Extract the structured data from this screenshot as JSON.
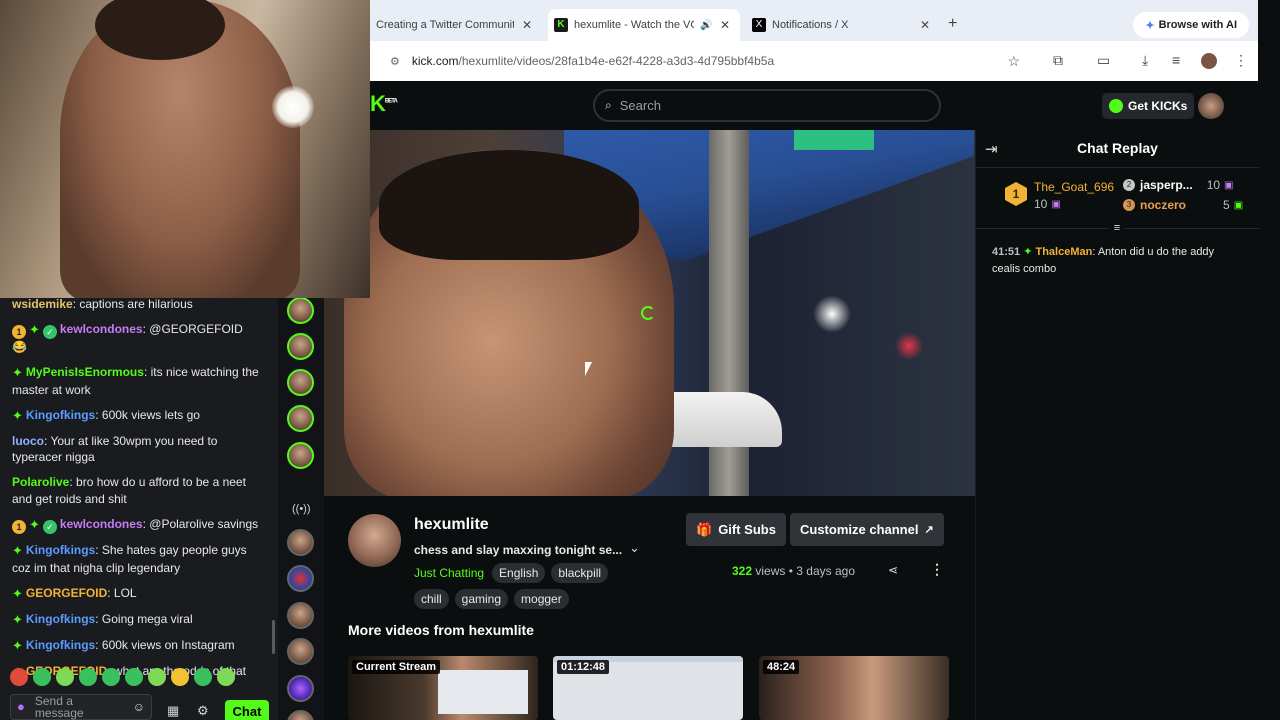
{
  "browser": {
    "tabs": [
      {
        "title": "Creating a Twitter Community",
        "active": false
      },
      {
        "title": "hexumlite - Watch the VO",
        "active": true
      },
      {
        "title": "Notifications / X",
        "active": false
      }
    ],
    "browse_ai": "Browse with AI",
    "url_domain": "kick.com",
    "url_path": "/hexumlite/videos/28fa1b4e-e62f-4228-a3d3-4d795bbf4b5a"
  },
  "kick": {
    "logo": "K",
    "logo_beta": "BETA",
    "search_placeholder": "Search",
    "get_kicks": "Get KICKs"
  },
  "left_chat": {
    "messages": [
      {
        "user": "wsidemike",
        "color": "#e8c36a",
        "text": ": captions are hilarious"
      },
      {
        "user": "kewlcondones",
        "color": "#c57cf4",
        "text": ": @GEORGEFOID 😂"
      },
      {
        "user": "MyPenisIsEnormous",
        "color": "#53fc18",
        "text": ": its nice watching the master at work"
      },
      {
        "user": "Kingofkings",
        "color": "#5b9cff",
        "text": ": 600k views lets go"
      },
      {
        "user": "luoco",
        "color": "#8fb3ff",
        "text": ": Your at like 30wpm you need to typeracer nigga"
      },
      {
        "user": "Polarolive",
        "color": "#53fc18",
        "text": ": bro how do u afford to be a neet and get roids and shit"
      },
      {
        "user": "kewlcondones",
        "color": "#c57cf4",
        "text": ": @Polarolive savings"
      },
      {
        "user": "Kingofkings",
        "color": "#5b9cff",
        "text": ": She hates gay people guys coz im that nigha clip legendary"
      },
      {
        "user": "GEORGEFOID",
        "color": "#f2b233",
        "text": ": LOL"
      },
      {
        "user": "Kingofkings",
        "color": "#5b9cff",
        "text": ": Going mega viral"
      },
      {
        "user": "Kingofkings",
        "color": "#5b9cff",
        "text": ": 600k views on Instagram"
      },
      {
        "user": "GEORGEFOID",
        "color": "#f2b233",
        "text": ": what are the odds of that"
      }
    ],
    "send_placeholder": "Send a message",
    "chat_button": "Chat"
  },
  "replay": {
    "title": "Chat Replay",
    "leaders": [
      {
        "rank": "1",
        "user": "The_Goat_696",
        "count": "10"
      },
      {
        "rank": "2",
        "user": "jasperp...",
        "count": "10"
      },
      {
        "rank": "3",
        "user": "noczero",
        "count": "5"
      }
    ],
    "message": {
      "time": "41:51",
      "user": "ThalceMan",
      "text": ": Anton did u do the addy cealis combo"
    }
  },
  "channel": {
    "name": "hexumlite",
    "stream_title": "chess and slay maxxing tonight se...",
    "category": "Just Chatting",
    "tags": [
      "English",
      "blackpill",
      "chill",
      "gaming",
      "mogger"
    ],
    "gift_subs": "Gift Subs",
    "customize": "Customize channel",
    "views_count": "322",
    "views_label": "views",
    "ago": "3 days ago",
    "more_title": "More videos from hexumlite",
    "thumbs": [
      {
        "label": "Current Stream"
      },
      {
        "label": "01:12:48"
      },
      {
        "label": "48:24"
      }
    ]
  },
  "colors": {
    "kick_green": "#53fc18",
    "bg": "#0b0e0f"
  }
}
